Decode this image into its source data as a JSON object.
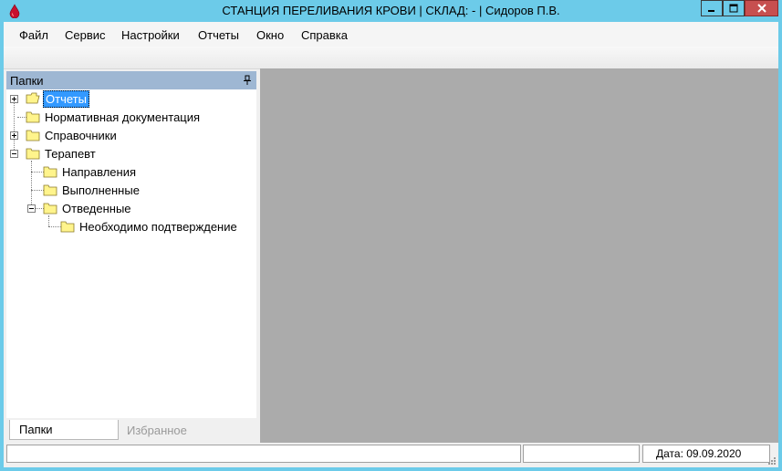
{
  "window": {
    "title": "СТАНЦИЯ ПЕРЕЛИВАНИЯ КРОВИ | СКЛАД: - | Сидоров П.В.",
    "app_icon": "blood-drop-icon"
  },
  "menu": [
    "Файл",
    "Сервис",
    "Настройки",
    "Отчеты",
    "Окно",
    "Справка"
  ],
  "panel": {
    "title": "Папки",
    "pin_icon": "pin-icon"
  },
  "tree": [
    {
      "label": "Отчеты",
      "selected": true,
      "expander": "plus"
    },
    {
      "label": "Нормативная документация"
    },
    {
      "label": "Справочники",
      "expander": "plus"
    },
    {
      "label": "Терапевт",
      "expander": "minus"
    },
    {
      "label": "Направления"
    },
    {
      "label": "Выполненные"
    },
    {
      "label": "Отведенные",
      "expander": "minus"
    },
    {
      "label": "Необходимо подтверждение"
    }
  ],
  "tabs": {
    "active": "Папки",
    "inactive": "Избранное"
  },
  "status": {
    "panel1": "",
    "panel2": "",
    "date": "Дата: 09.09.2020"
  },
  "colors": {
    "titlebar": "#6ccbe9",
    "mdi_background": "#ababab",
    "panel_header": "#9eb7d3",
    "selection": "#3399ff",
    "close_button": "#c74f4f",
    "folder": "#fff48c"
  }
}
